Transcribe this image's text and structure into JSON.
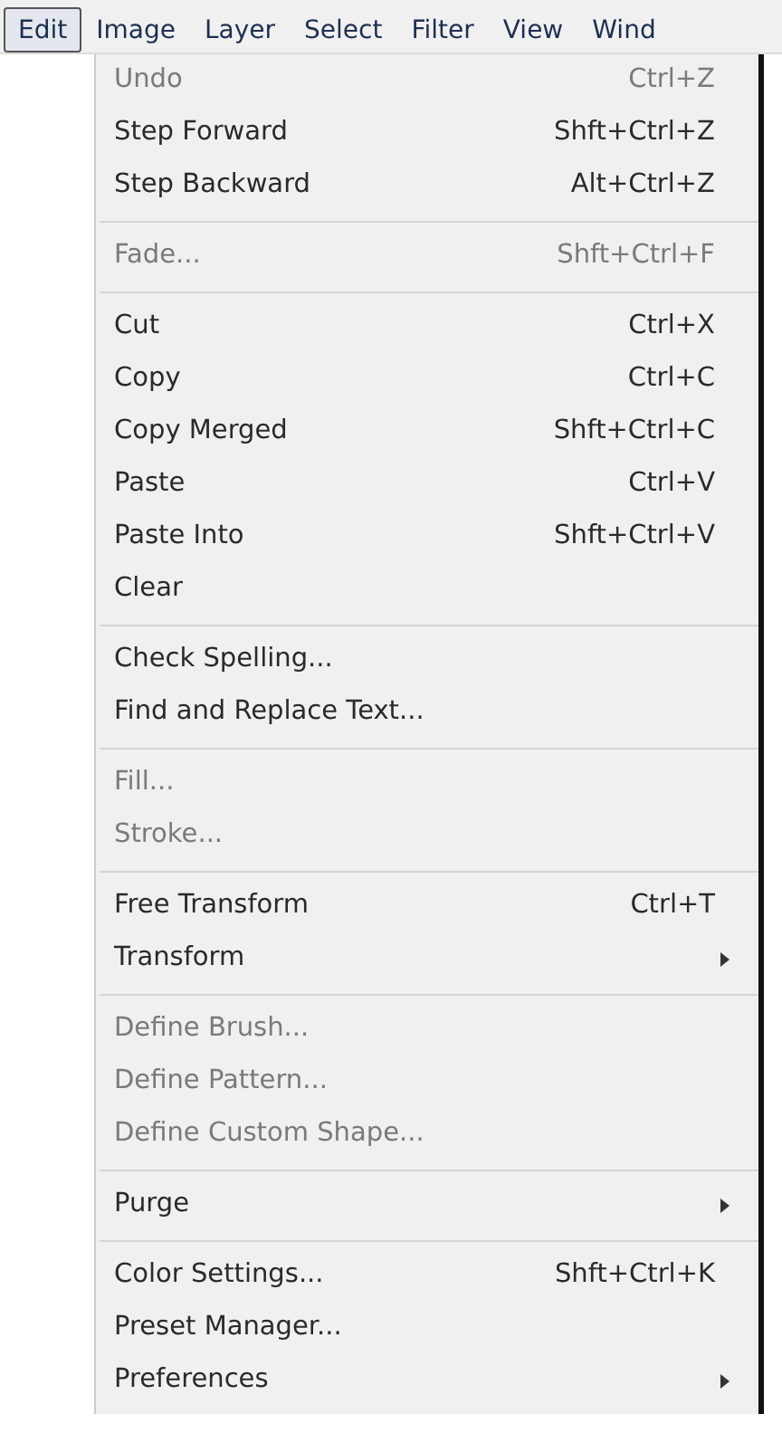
{
  "menubar": [
    {
      "label": "Edit",
      "selected": true
    },
    {
      "label": "Image",
      "selected": false
    },
    {
      "label": "Layer",
      "selected": false
    },
    {
      "label": "Select",
      "selected": false
    },
    {
      "label": "Filter",
      "selected": false
    },
    {
      "label": "View",
      "selected": false
    },
    {
      "label": "Wind",
      "selected": false
    }
  ],
  "menu": {
    "sections": [
      [
        {
          "label": "Undo",
          "shortcut": "Ctrl+Z",
          "disabled": true,
          "submenu": false
        },
        {
          "label": "Step Forward",
          "shortcut": "Shft+Ctrl+Z",
          "disabled": false,
          "submenu": false
        },
        {
          "label": "Step Backward",
          "shortcut": "Alt+Ctrl+Z",
          "disabled": false,
          "submenu": false
        }
      ],
      [
        {
          "label": "Fade...",
          "shortcut": "Shft+Ctrl+F",
          "disabled": true,
          "submenu": false
        }
      ],
      [
        {
          "label": "Cut",
          "shortcut": "Ctrl+X",
          "disabled": false,
          "submenu": false
        },
        {
          "label": "Copy",
          "shortcut": "Ctrl+C",
          "disabled": false,
          "submenu": false
        },
        {
          "label": "Copy Merged",
          "shortcut": "Shft+Ctrl+C",
          "disabled": false,
          "submenu": false
        },
        {
          "label": "Paste",
          "shortcut": "Ctrl+V",
          "disabled": false,
          "submenu": false
        },
        {
          "label": "Paste Into",
          "shortcut": "Shft+Ctrl+V",
          "disabled": false,
          "submenu": false
        },
        {
          "label": "Clear",
          "disabled": false,
          "submenu": false
        }
      ],
      [
        {
          "label": "Check Spelling...",
          "disabled": false,
          "submenu": false
        },
        {
          "label": "Find and Replace Text...",
          "disabled": false,
          "submenu": false
        }
      ],
      [
        {
          "label": "Fill...",
          "disabled": true,
          "submenu": false
        },
        {
          "label": "Stroke...",
          "disabled": true,
          "submenu": false
        }
      ],
      [
        {
          "label": "Free Transform",
          "shortcut": "Ctrl+T",
          "disabled": false,
          "submenu": false
        },
        {
          "label": "Transform",
          "disabled": false,
          "submenu": true
        }
      ],
      [
        {
          "label": "Define Brush...",
          "disabled": true,
          "submenu": false
        },
        {
          "label": "Define Pattern...",
          "disabled": true,
          "submenu": false
        },
        {
          "label": "Define Custom Shape...",
          "disabled": true,
          "submenu": false
        }
      ],
      [
        {
          "label": "Purge",
          "disabled": false,
          "submenu": true
        }
      ],
      [
        {
          "label": "Color Settings...",
          "shortcut": "Shft+Ctrl+K",
          "disabled": false,
          "submenu": false
        },
        {
          "label": "Preset Manager...",
          "disabled": false,
          "submenu": false
        },
        {
          "label": "Preferences",
          "disabled": false,
          "submenu": true
        }
      ]
    ]
  }
}
